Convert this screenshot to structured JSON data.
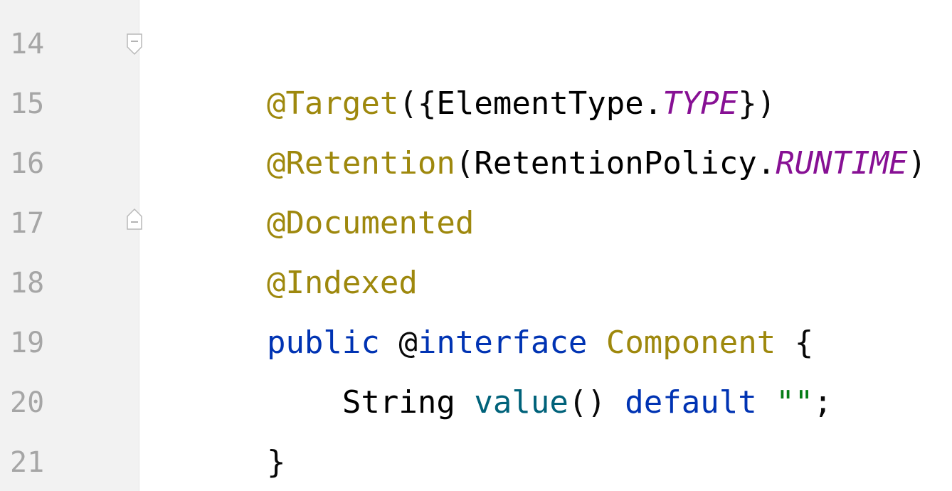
{
  "editor": {
    "line_numbers": [
      "14",
      "15",
      "16",
      "17",
      "18",
      "19",
      "20",
      "21"
    ],
    "lines": [
      [
        {
          "text": "@Target",
          "kind": "annotation"
        },
        {
          "text": "({",
          "kind": "punct"
        },
        {
          "text": "ElementType.",
          "kind": "class"
        },
        {
          "text": "TYPE",
          "kind": "const"
        },
        {
          "text": "})",
          "kind": "punct"
        }
      ],
      [
        {
          "text": "@Retention",
          "kind": "annotation"
        },
        {
          "text": "(",
          "kind": "punct"
        },
        {
          "text": "RetentionPolicy.",
          "kind": "class"
        },
        {
          "text": "RUNTIME",
          "kind": "const"
        },
        {
          "text": ")",
          "kind": "punct"
        }
      ],
      [
        {
          "text": "@Documented",
          "kind": "annotation"
        }
      ],
      [
        {
          "text": "@Indexed",
          "kind": "annotation"
        }
      ],
      [
        {
          "text": "public",
          "kind": "keyword"
        },
        {
          "text": " ",
          "kind": "punct"
        },
        {
          "text": "@",
          "kind": "punct"
        },
        {
          "text": "interface",
          "kind": "keyword"
        },
        {
          "text": " ",
          "kind": "punct"
        },
        {
          "text": "Component",
          "kind": "type"
        },
        {
          "text": " {",
          "kind": "punct"
        }
      ],
      [
        {
          "text": "    String",
          "kind": "class"
        },
        {
          "text": " ",
          "kind": "punct"
        },
        {
          "text": "value",
          "kind": "method"
        },
        {
          "text": "() ",
          "kind": "punct"
        },
        {
          "text": "default",
          "kind": "keyword"
        },
        {
          "text": " ",
          "kind": "punct"
        },
        {
          "text": "\"\"",
          "kind": "string"
        },
        {
          "text": ";",
          "kind": "punct"
        }
      ],
      [
        {
          "text": "}",
          "kind": "punct"
        }
      ],
      []
    ],
    "fold_markers": [
      {
        "line_index": 0,
        "icon": "fold-collapse-icon"
      },
      {
        "line_index": 3,
        "icon": "fold-end-icon"
      }
    ]
  }
}
